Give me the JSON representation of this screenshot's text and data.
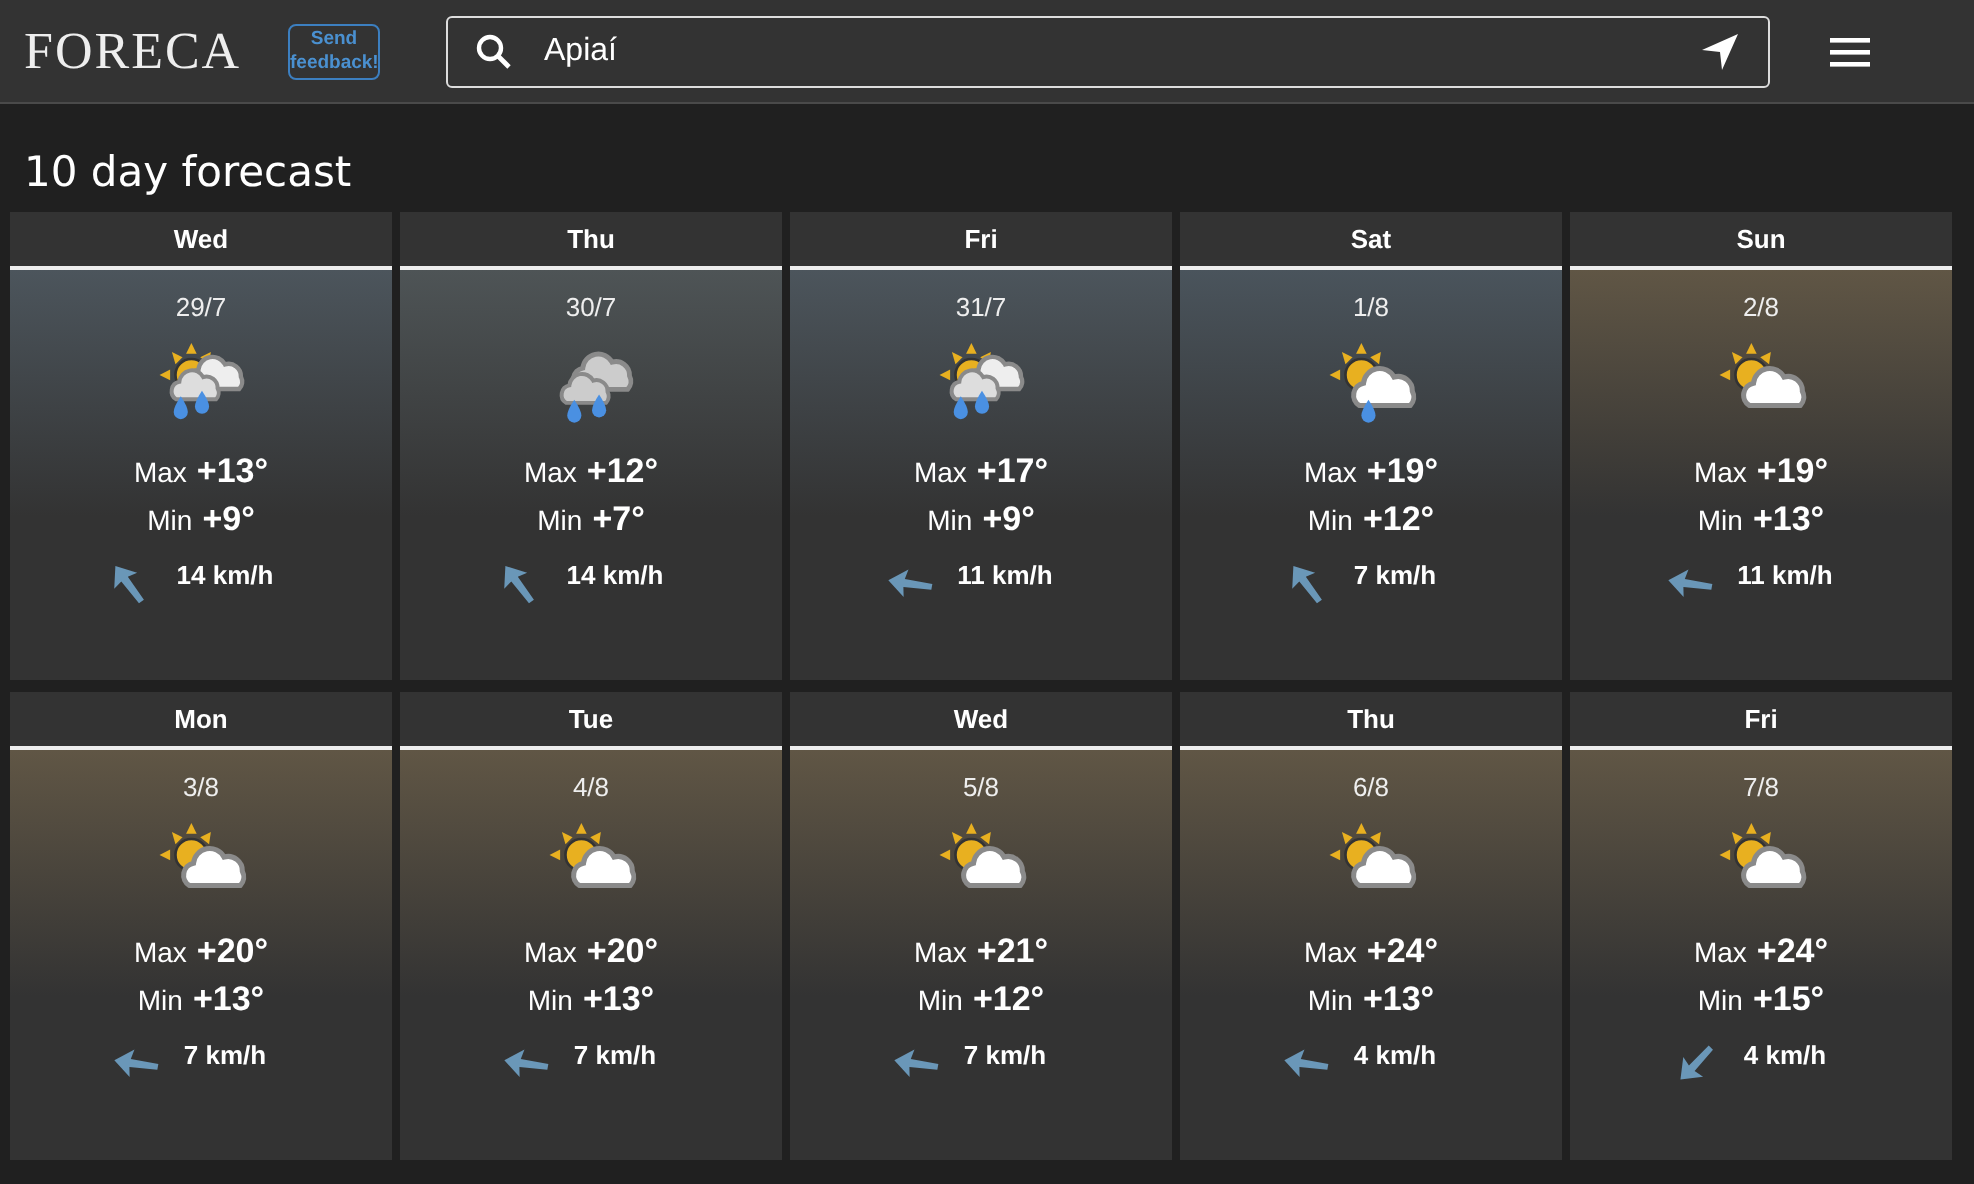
{
  "header": {
    "logo": "FORECA",
    "feedback": "Send feedback!",
    "search": {
      "value": "Apiaí"
    }
  },
  "title": "10 day forecast",
  "days": [
    {
      "weekday": "Wed",
      "date": "29/7",
      "kind": "sun-clouds-rain",
      "max_label": "Max",
      "max": "+13°",
      "min_label": "Min",
      "min": "+9°",
      "wind": {
        "kind": "nw",
        "speed": "14 km/h"
      }
    },
    {
      "weekday": "Thu",
      "date": "30/7",
      "kind": "clouds-rain",
      "max_label": "Max",
      "max": "+12°",
      "min_label": "Min",
      "min": "+7°",
      "wind": {
        "kind": "nw",
        "speed": "14 km/h"
      }
    },
    {
      "weekday": "Fri",
      "date": "31/7",
      "kind": "sun-clouds-rain",
      "max_label": "Max",
      "max": "+17°",
      "min_label": "Min",
      "min": "+9°",
      "wind": {
        "kind": "w",
        "speed": "11 km/h"
      }
    },
    {
      "weekday": "Sat",
      "date": "1/8",
      "kind": "sun-cloud-rain",
      "max_label": "Max",
      "max": "+19°",
      "min_label": "Min",
      "min": "+12°",
      "wind": {
        "kind": "nw",
        "speed": "7 km/h"
      }
    },
    {
      "weekday": "Sun",
      "date": "2/8",
      "kind": "sun-cloud",
      "max_label": "Max",
      "max": "+19°",
      "min_label": "Min",
      "min": "+13°",
      "wind": {
        "kind": "w",
        "speed": "11 km/h"
      }
    },
    {
      "weekday": "Mon",
      "date": "3/8",
      "kind": "sun-cloud",
      "max_label": "Max",
      "max": "+20°",
      "min_label": "Min",
      "min": "+13°",
      "wind": {
        "kind": "w",
        "speed": "7 km/h"
      }
    },
    {
      "weekday": "Tue",
      "date": "4/8",
      "kind": "sun-cloud",
      "max_label": "Max",
      "max": "+20°",
      "min_label": "Min",
      "min": "+13°",
      "wind": {
        "kind": "w",
        "speed": "7 km/h"
      }
    },
    {
      "weekday": "Wed",
      "date": "5/8",
      "kind": "sun-cloud",
      "max_label": "Max",
      "max": "+21°",
      "min_label": "Min",
      "min": "+12°",
      "wind": {
        "kind": "w",
        "speed": "7 km/h"
      }
    },
    {
      "weekday": "Thu",
      "date": "6/8",
      "kind": "sun-cloud",
      "max_label": "Max",
      "max": "+24°",
      "min_label": "Min",
      "min": "+13°",
      "wind": {
        "kind": "w",
        "speed": "4 km/h"
      }
    },
    {
      "weekday": "Fri",
      "date": "7/8",
      "kind": "sun-cloud",
      "max_label": "Max",
      "max": "+24°",
      "min_label": "Min",
      "min": "+15°",
      "wind": {
        "kind": "sw",
        "speed": "4 km/h"
      }
    }
  ]
}
